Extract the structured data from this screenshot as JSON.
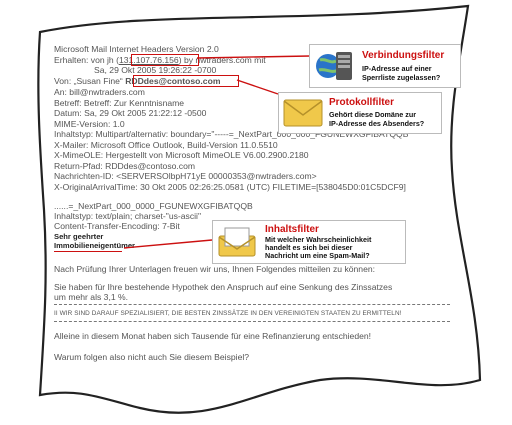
{
  "header_lines": [
    "Microsoft Mail Internet Headers Version 2.0",
    "Sa, 29 Okt 2005 19:26:22 -0700",
    "Betreff: Betreff: Zur Kenntnisname",
    "Datum: Sa, 29 Okt 2005 21:22:12 -0500",
    "MIME-Version: 1.0",
    "Inhaltstyp: Multipart/alternativ: boundary=\"-----=_NextPart_000_000_FGUNEWXGFIBATQQB\"",
    "X-Mailer: Microsoft Office Outlook, Build-Version 11.0.5510",
    "X-MimeOLE: Hergestellt von Microsoft MimeOLE V6.00.2900.2180",
    "Return-Pfad: RDDdes@contoso.com",
    "Nachrichten-ID: <SERVERSOlbpH71yE 00000353@nwtraders.com>",
    "X-OriginalArrivalTime: 30 Okt 2005 02:26:25.0581 (UTC) FILETIME=[538045D0:01C5DCF9]"
  ],
  "received": {
    "prefix": "Erhalten: von jh (",
    "ip": "131.107.76.156",
    "suffix": ") by nwtraders.com mit"
  },
  "from": {
    "prefix": "Von: „Susan Fine“ ",
    "address": "RDDdes@contoso.com"
  },
  "to": "An: bill@nwtraders.com",
  "body_header_lines": [
    "......=_NextPart_000_0000_FGUNEWXGFIBATQQB",
    "Inhaltstyp: text/plain; charset-\"us-ascii\"",
    "Content-Transfer-Encoding: 7-Bit"
  ],
  "salutation": [
    "Sehr geehrter",
    "Immobilieneigentümer"
  ],
  "body_lines": [
    "Nach Prüfung Ihrer Unterlagen freuen wir uns, Ihnen Folgendes mitteilen zu können:",
    "Sie haben für Ihre bestehende Hypothek den Anspruch auf eine Senkung des Zinssatzes",
    "um mehr als 3,1 %."
  ],
  "caps_line": "II WIR SIND DARAUF SPEZIALISIERT, DIE BESTEN ZINSSÄTZE IN DEN VEREINIGTEN STAATEN ZU ERMITTELN!",
  "closing_lines": [
    "Alleine in diesem Monat haben sich Tausende für eine Refinanzierung entschieden!",
    "Warum folgen also nicht auch Sie diesem Beispiel?"
  ],
  "callouts": {
    "connection": {
      "title": "Verbindungsfilter",
      "desc": [
        "IP-Adresse auf einer",
        "Sperrliste zugelassen?"
      ],
      "icon": "server-globe-icon"
    },
    "protocol": {
      "title": "Protokollfilter",
      "desc": [
        "Gehört diese Domäne zur",
        "IP-Adresse des Absenders?"
      ],
      "icon": "envelope-icon"
    },
    "content": {
      "title": "Inhaltsfilter",
      "desc": [
        "Mit welcher Wahrscheinlichkeit",
        "handelt es sich bei dieser",
        "Nachricht um eine Spam-Mail?"
      ],
      "icon": "open-envelope-icon"
    }
  },
  "colors": {
    "accent": "#cc1010",
    "text": "#555555",
    "page_border": "#222222"
  }
}
